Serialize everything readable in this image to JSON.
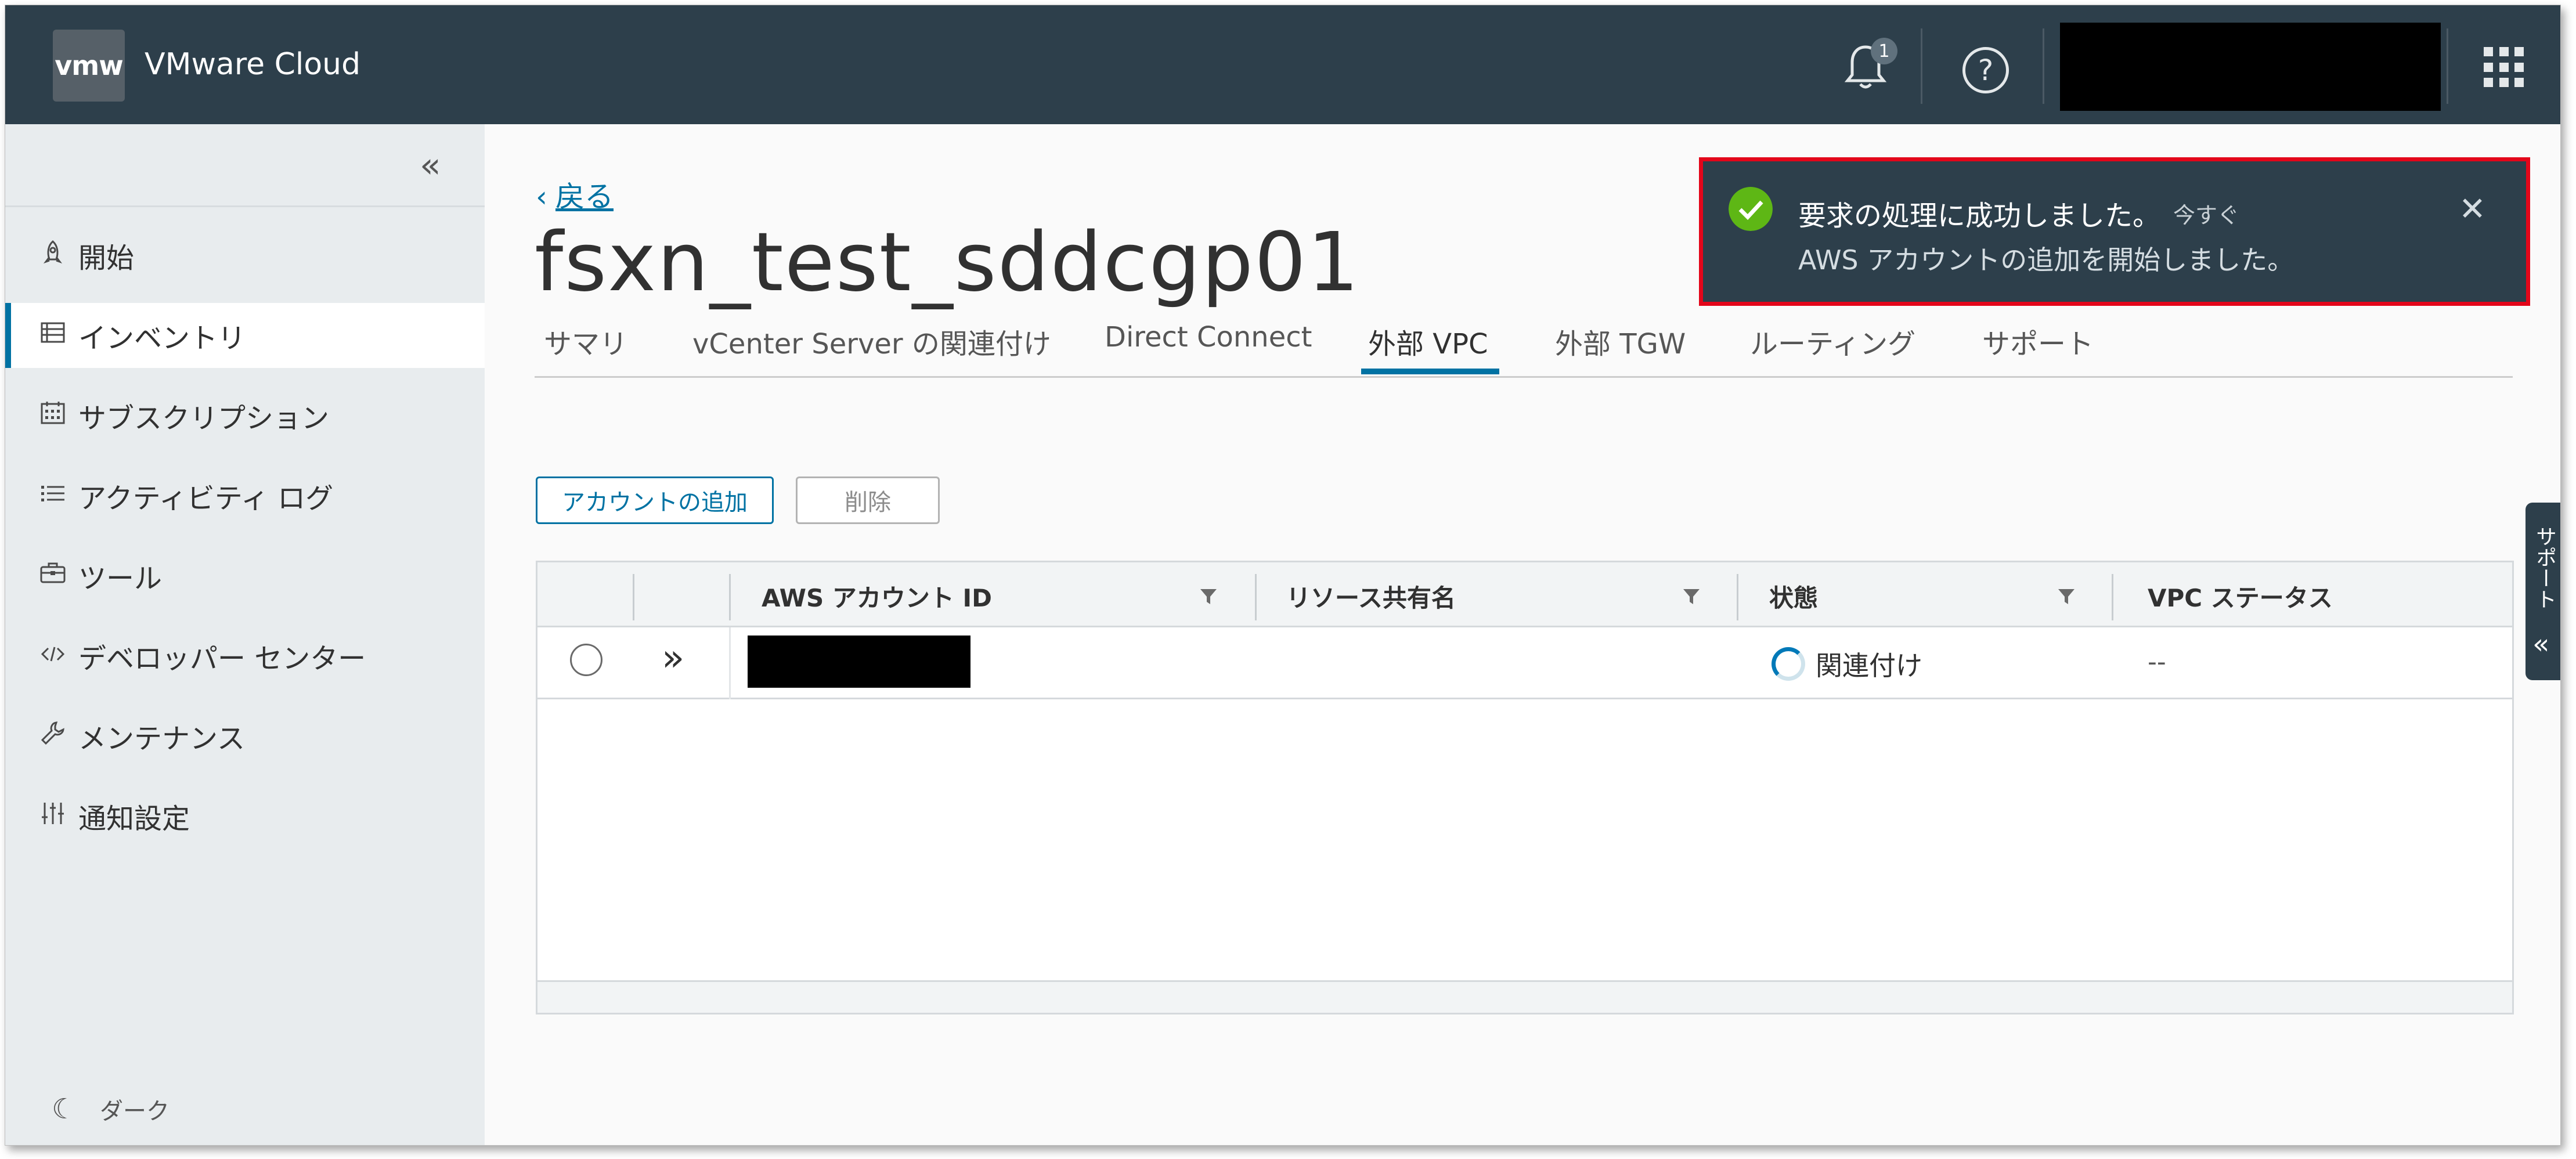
{
  "header": {
    "logo_text": "vmw",
    "app_title": "VMware Cloud",
    "notification_count": "1",
    "help_glyph": "?"
  },
  "sidebar": {
    "items": [
      {
        "label": "開始",
        "icon": "rocket-icon"
      },
      {
        "label": "インベントリ",
        "icon": "inventory-icon",
        "active": true
      },
      {
        "label": "サブスクリプション",
        "icon": "calendar-icon"
      },
      {
        "label": "アクティビティ ログ",
        "icon": "list-icon"
      },
      {
        "label": "ツール",
        "icon": "toolbox-icon"
      },
      {
        "label": "デベロッパー センター",
        "icon": "code-icon"
      },
      {
        "label": "メンテナンス",
        "icon": "wrench-icon"
      },
      {
        "label": "通知設定",
        "icon": "sliders-icon"
      }
    ],
    "dark_mode_label": "ダーク"
  },
  "main": {
    "back_label": "戻る",
    "title": "fsxn_test_sddcgp01",
    "tabs": [
      {
        "label": "サマリ"
      },
      {
        "label": "vCenter Server の関連付け"
      },
      {
        "label": "Direct Connect"
      },
      {
        "label": "外部 VPC",
        "active": true
      },
      {
        "label": "外部 TGW"
      },
      {
        "label": "ルーティング"
      },
      {
        "label": "サポート"
      }
    ],
    "buttons": {
      "add_account": "アカウントの追加",
      "delete": "削除"
    },
    "table": {
      "columns": [
        "AWS アカウント ID",
        "リソース共有名",
        "状態",
        "VPC ステータス"
      ],
      "rows": [
        {
          "aws_account_id": "",
          "resource_share_name": "",
          "state": "関連付け",
          "vpc_status": "--"
        }
      ]
    }
  },
  "support_tab": {
    "label": "サポート"
  },
  "toast": {
    "title": "要求の処理に成功しました。",
    "time": "今すぐ",
    "message": "AWS アカウントの追加を開始しました。",
    "border_color": "#e3061a",
    "success_color": "#5eb715"
  },
  "colors": {
    "header_bg": "#2d3f4b",
    "accent": "#0072a3",
    "sidebar_bg": "#e8ecee"
  }
}
